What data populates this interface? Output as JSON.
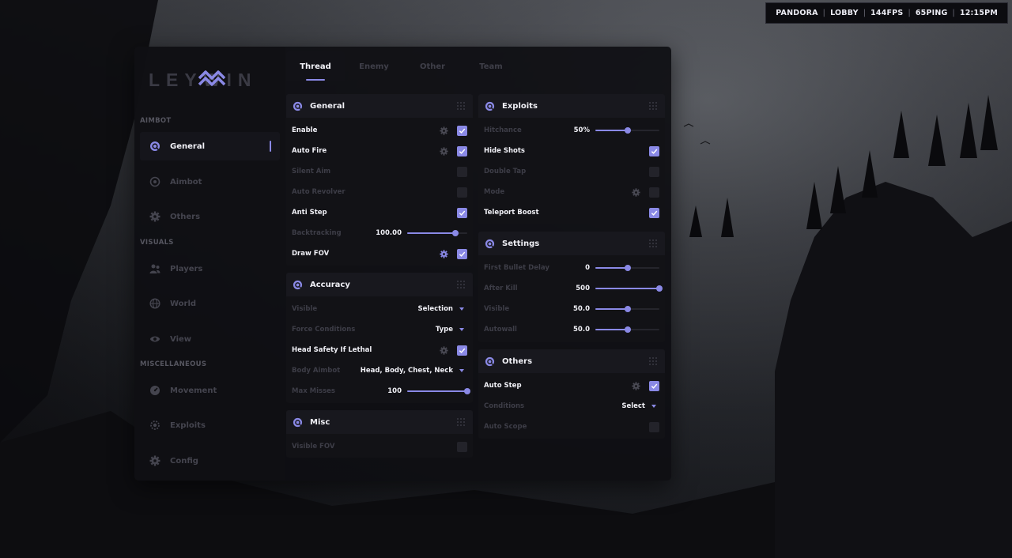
{
  "hud": {
    "items": [
      "PANDORA",
      "LOBBY",
      "144FPS",
      "65PING",
      "12:15PM"
    ]
  },
  "brand": {
    "logo_text": "LEYWIN"
  },
  "sidebar": {
    "sections": {
      "aimbot": "AIMBOT",
      "visuals": "VISUALS",
      "misc": "MISCELLANEOUS"
    },
    "items": [
      {
        "label": "General",
        "icon": "crosshair-icon",
        "active": true
      },
      {
        "label": "Aimbot",
        "icon": "target-icon",
        "active": false
      },
      {
        "label": "Others",
        "icon": "gear-icon",
        "active": false
      },
      {
        "label": "Players",
        "icon": "users-icon",
        "active": false
      },
      {
        "label": "World",
        "icon": "globe-icon",
        "active": false
      },
      {
        "label": "View",
        "icon": "eye-icon",
        "active": false
      },
      {
        "label": "Movement",
        "icon": "speed-icon",
        "active": false
      },
      {
        "label": "Exploits",
        "icon": "bug-icon",
        "active": false
      },
      {
        "label": "Config",
        "icon": "gear-icon",
        "active": false
      }
    ]
  },
  "tabs": [
    {
      "label": "Thread",
      "active": true
    },
    {
      "label": "Enemy",
      "active": false
    },
    {
      "label": "Other",
      "active": false
    },
    {
      "label": "Team",
      "active": false
    }
  ],
  "panels": {
    "general": {
      "title": "General",
      "rows": [
        {
          "label": "Enable",
          "checked": true,
          "gear": true
        },
        {
          "label": "Auto Fire",
          "checked": true,
          "gear": true
        },
        {
          "label": "Silent Aim",
          "checked": false
        },
        {
          "label": "Auto Revolver",
          "checked": false
        },
        {
          "label": "Anti Step",
          "checked": true
        },
        {
          "label": "Backtracking",
          "value": "100.00",
          "slider": 0.8
        },
        {
          "label": "Draw FOV",
          "checked": true,
          "gear": true,
          "gear_active": true
        }
      ]
    },
    "accuracy": {
      "title": "Accuracy",
      "rows": [
        {
          "label": "Visible",
          "dropdown": "Selection"
        },
        {
          "label": "Force Conditions",
          "dropdown": "Type"
        },
        {
          "label": "Head Safety If Lethal",
          "checked": true,
          "gear": true
        },
        {
          "label": "Body Aimbot",
          "dropdown": "Head, Body, Chest, Neck"
        },
        {
          "label": "Max Misses",
          "value": "100",
          "slider": 1.0
        }
      ]
    },
    "misc": {
      "title": "Misc",
      "rows": [
        {
          "label": "Visible FOV",
          "checked": false
        }
      ]
    },
    "exploits": {
      "title": "Exploits",
      "rows": [
        {
          "label": "Hitchance",
          "value": "50%",
          "slider": 0.5
        },
        {
          "label": "Hide Shots",
          "checked": true
        },
        {
          "label": "Double Tap",
          "checked": false
        },
        {
          "label": "Mode",
          "checked": false,
          "gear": true
        },
        {
          "label": "Teleport Boost",
          "checked": true
        }
      ]
    },
    "settings": {
      "title": "Settings",
      "rows": [
        {
          "label": "First Bullet Delay",
          "value": "0",
          "slider": 0.5
        },
        {
          "label": "After Kill",
          "value": "500",
          "slider": 1.0
        },
        {
          "label": "Visible",
          "value": "50.0",
          "slider": 0.5
        },
        {
          "label": "Autowall",
          "value": "50.0",
          "slider": 0.5
        }
      ]
    },
    "others": {
      "title": "Others",
      "rows": [
        {
          "label": "Auto Step",
          "checked": true,
          "gear": true
        },
        {
          "label": "Conditions",
          "dropdown": "Select"
        },
        {
          "label": "Auto Scope",
          "checked": false
        }
      ]
    }
  },
  "colors": {
    "accent": "#8a89e6",
    "panel": "#121216",
    "header": "#18181e"
  }
}
